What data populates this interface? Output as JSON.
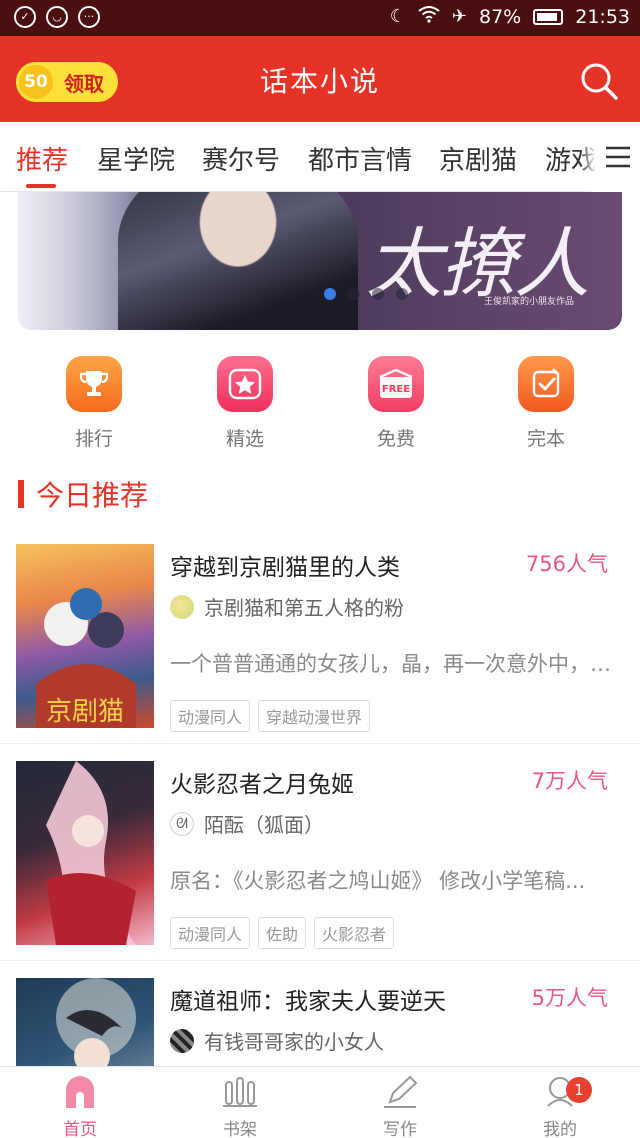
{
  "status_bar": {
    "battery": "87%",
    "time": "21:53"
  },
  "header": {
    "coin_value": "50",
    "coin_label": "领取",
    "title": "话本小说",
    "search_icon": "search-icon"
  },
  "tabs": [
    {
      "label": "推荐",
      "active": true
    },
    {
      "label": "星学院"
    },
    {
      "label": "赛尔号"
    },
    {
      "label": "都市言情"
    },
    {
      "label": "京剧猫"
    },
    {
      "label": "游戏"
    }
  ],
  "banner": {
    "headline": "太撩人",
    "subline": "王俊凯家的小朋友作品",
    "page_count": 4,
    "active_index": 0
  },
  "quick_entries": [
    {
      "label": "排行",
      "icon": "trophy-icon",
      "color": "#f7882f"
    },
    {
      "label": "精选",
      "icon": "star-icon",
      "color": "#f2436b"
    },
    {
      "label": "免费",
      "icon": "free-icon",
      "color": "#f25a74"
    },
    {
      "label": "完本",
      "icon": "check-note-icon",
      "color": "#f5702f"
    }
  ],
  "section": {
    "title": "今日推荐"
  },
  "books": [
    {
      "title": "穿越到京剧猫里的人类",
      "popularity": "756人气",
      "author": "京剧猫和第五人格的粉",
      "description": "一个普普通通的女孩儿，晶，再一次意外中，…",
      "tags": [
        "动漫同人",
        "穿越动漫世界"
      ]
    },
    {
      "title": "火影忍者之月兔姬",
      "popularity": "7万人气",
      "author": "陌酝（狐面）",
      "description": "原名：《火影忍者之鸠山姬》 修改小学笔稿...",
      "tags": [
        "动漫同人",
        "佐助",
        "火影忍者"
      ]
    },
    {
      "title": "魔道祖师：我家夫人要逆天",
      "popularity": "5万人气",
      "author": "有钱哥哥家的小女人",
      "description": "",
      "tags": []
    }
  ],
  "bottom_nav": [
    {
      "label": "首页",
      "icon": "home-icon",
      "active": true
    },
    {
      "label": "书架",
      "icon": "bookshelf-icon"
    },
    {
      "label": "写作",
      "icon": "pen-icon"
    },
    {
      "label": "我的",
      "icon": "profile-icon",
      "badge": "1"
    }
  ],
  "colors": {
    "brand_red": "#e63328",
    "pink_accent": "#e8577f",
    "coin_yellow": "#fde03a"
  }
}
